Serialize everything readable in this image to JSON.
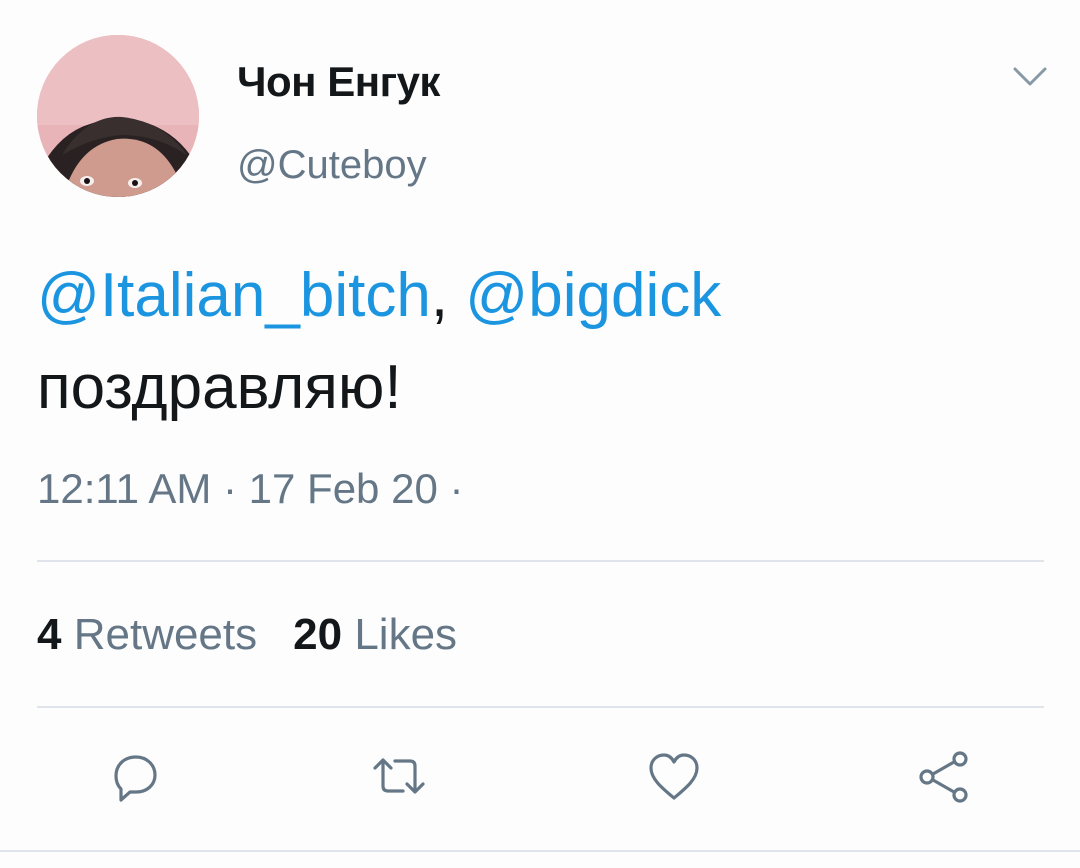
{
  "author": {
    "display_name": "Чон Енгук",
    "handle": "@Cuteboy"
  },
  "tweet": {
    "mention_1": "@Italian_bitch",
    "separator": ", ",
    "mention_2": "@bigdick",
    "body": "поздравляю!",
    "timestamp": "12:11 AM · 17 Feb 20 ·"
  },
  "stats": {
    "retweets_count": "4",
    "retweets_label": "Retweets",
    "likes_count": "20",
    "likes_label": "Likes"
  },
  "icons": {
    "menu": "chevron-down-icon",
    "reply": "reply-icon",
    "retweet": "retweet-icon",
    "like": "heart-icon",
    "share": "share-icon"
  },
  "colors": {
    "mention": "#1b95e0",
    "secondary_text": "#657786",
    "primary_text": "#14171a",
    "icon": "#657786",
    "divider": "#dfe5ea"
  }
}
